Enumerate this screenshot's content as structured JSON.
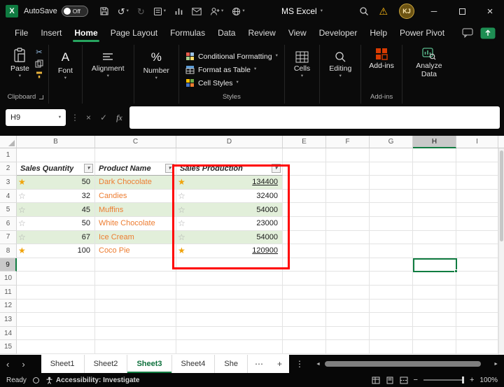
{
  "colors": {
    "accent_green": "#107C41",
    "band_green": "#E2EFDA",
    "product_orange": "#ED7D31",
    "highlight_red": "#FF0000",
    "star_gold": "#F0A30A"
  },
  "titlebar": {
    "autosave_label": "AutoSave",
    "autosave_state": "Off",
    "app_title": "MS Excel",
    "avatar_initials": "KJ"
  },
  "menubar": {
    "items": [
      "File",
      "Insert",
      "Home",
      "Page Layout",
      "Formulas",
      "Data",
      "Review",
      "View",
      "Developer",
      "Help",
      "Power Pivot"
    ],
    "active_item": "Home"
  },
  "ribbon": {
    "paste_label": "Paste",
    "clipboard_group_label": "Clipboard",
    "font_group_label": "Font",
    "alignment_group_label": "Alignment",
    "number_group_label": "Number",
    "conditional_formatting_label": "Conditional Formatting",
    "format_as_table_label": "Format as Table",
    "cell_styles_label": "Cell Styles",
    "styles_group_label": "Styles",
    "cells_group_label": "Cells",
    "editing_group_label": "Editing",
    "addins_button_label": "Add-ins",
    "addins_group_label": "Add-ins",
    "analyze_data_label": "Analyze Data"
  },
  "formula_bar": {
    "name_box_value": "H9",
    "fx_label": "fx",
    "formula_value": ""
  },
  "grid": {
    "column_headers": [
      "B",
      "C",
      "D",
      "E",
      "F",
      "G",
      "H",
      "I"
    ],
    "row_headers": [
      "1",
      "2",
      "3",
      "4",
      "5",
      "6",
      "7",
      "8",
      "9",
      "10",
      "11",
      "12",
      "13",
      "14",
      "15"
    ],
    "selected_column": "H",
    "selected_row": "9",
    "selected_cell": "H9",
    "table": {
      "headers": [
        "Sales Quantity",
        "Product Name",
        "Sales Production"
      ],
      "rows": [
        {
          "quantity": "50",
          "product": "Dark Chocolate",
          "production": "134400",
          "quantity_star": "gold",
          "production_star": "gold",
          "production_underlined": true,
          "banded": true
        },
        {
          "quantity": "32",
          "product": "Candies",
          "production": "32400",
          "quantity_star": "empty",
          "production_star": "empty",
          "production_underlined": false,
          "banded": false
        },
        {
          "quantity": "45",
          "product": "Muffins",
          "production": "54000",
          "quantity_star": "empty",
          "production_star": "empty",
          "production_underlined": false,
          "banded": true
        },
        {
          "quantity": "50",
          "product": "White Chocolate",
          "production": "23000",
          "quantity_star": "empty",
          "production_star": "empty",
          "production_underlined": false,
          "banded": false
        },
        {
          "quantity": "67",
          "product": "Ice Cream",
          "production": "54000",
          "quantity_star": "empty",
          "production_star": "empty",
          "production_underlined": false,
          "banded": true
        },
        {
          "quantity": "100",
          "product": "Coco Pie",
          "production": "120900",
          "quantity_star": "gold",
          "production_star": "gold",
          "production_underlined": true,
          "banded": false
        }
      ]
    }
  },
  "sheet_tabs": {
    "tabs": [
      "Sheet1",
      "Sheet2",
      "Sheet3",
      "Sheet4",
      "She"
    ],
    "active_tab": "Sheet3"
  },
  "status_bar": {
    "ready_label": "Ready",
    "accessibility_label": "Accessibility: Investigate",
    "zoom_level": "100%"
  }
}
